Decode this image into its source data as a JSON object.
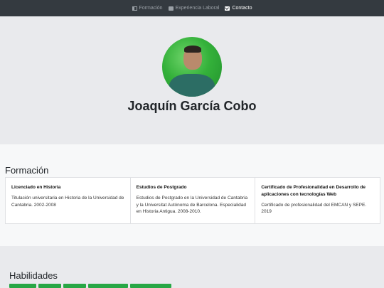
{
  "nav": {
    "items": [
      {
        "label": "Formación",
        "icon": "book-icon"
      },
      {
        "label": "Experiencia Laboral",
        "icon": "briefcase-icon"
      },
      {
        "label": "Contacto",
        "icon": "mail-icon"
      }
    ]
  },
  "hero": {
    "name": "Joaquín García Cobo"
  },
  "formacion": {
    "title": "Formación",
    "cards": [
      {
        "title": "Licenciado en Historia",
        "text": "Titulación universitaria en Historia de la Universidad de Cantabria. 2002-2008"
      },
      {
        "title": "Estudios de Postgrado",
        "text": "Estudios de Postgrado en la Universidad de Cantabria y la Universitat Autónoma de Barcelona. Especialidad en Historia Antigua. 2008-2010."
      },
      {
        "title": "Certificado de Profesionalidad en Desarrollo de aplicaciones con tecnologías Web",
        "text": "Certificado de profesionalidad del EMCAN y SEPE. 2019"
      }
    ]
  },
  "habilidades": {
    "title": "Habilidades",
    "accent": "#28a745"
  }
}
